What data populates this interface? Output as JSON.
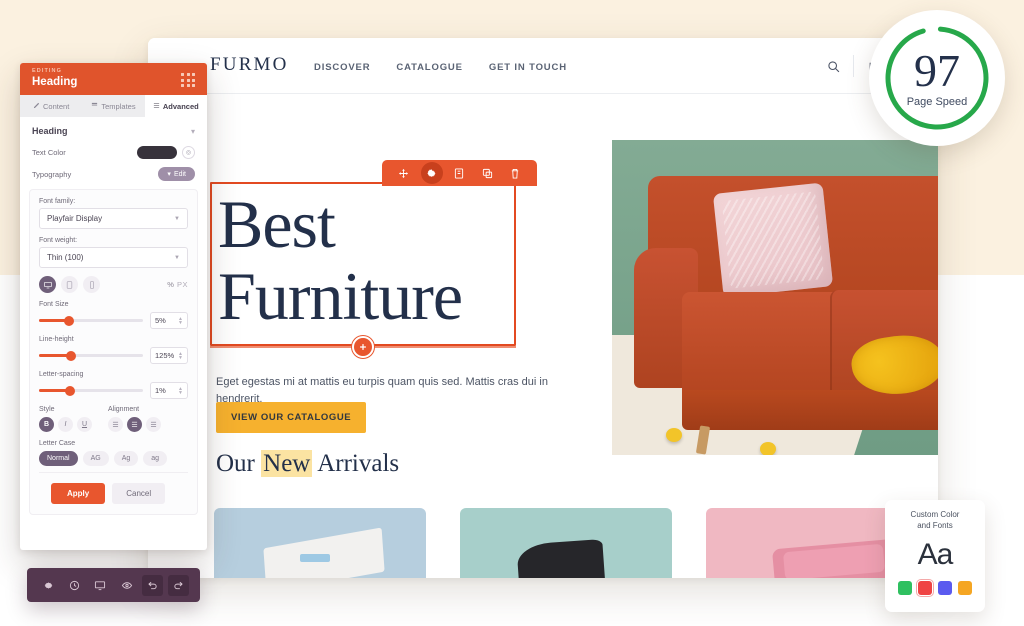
{
  "editor_panel": {
    "eyebrow": "EDITING",
    "title": "Heading",
    "drag_handle_icon": "grid-dots-icon",
    "tabs": [
      {
        "label": "Content",
        "icon": "pencil-icon",
        "active": false
      },
      {
        "label": "Templates",
        "icon": "template-icon",
        "active": false
      },
      {
        "label": "Advanced",
        "icon": "sliders-icon",
        "active": true
      }
    ],
    "section": {
      "title": "Heading",
      "collapse_icon": "chevron-down-icon"
    },
    "text_color": {
      "label": "Text Color",
      "swatch_hex": "#37323b",
      "picker_icon": "eyedropper-icon"
    },
    "typography": {
      "label": "Typography",
      "edit_label": "Edit",
      "edit_icon": "chevron-down-icon"
    },
    "font_family": {
      "label": "Font family:",
      "value": "Playfair Display",
      "caret_icon": "caret-down-icon"
    },
    "font_weight": {
      "label": "Font weight:",
      "value": "Thin (100)",
      "caret_icon": "caret-down-icon"
    },
    "devices": [
      {
        "name": "desktop-icon",
        "active": true
      },
      {
        "name": "tablet-icon",
        "active": false
      },
      {
        "name": "mobile-icon",
        "active": false
      }
    ],
    "units": {
      "percent": "%",
      "px": "PX",
      "active": "PX"
    },
    "sliders": [
      {
        "label": "Font Size",
        "value": "5%",
        "fill_pct": 28
      },
      {
        "label": "Line-height",
        "value": "125%",
        "fill_pct": 30
      },
      {
        "label": "Letter-spacing",
        "value": "1%",
        "fill_pct": 29
      }
    ],
    "style": {
      "label": "Style",
      "options": [
        {
          "glyph": "B",
          "name": "bold-button",
          "active": true
        },
        {
          "glyph": "I",
          "name": "italic-button",
          "active": false
        },
        {
          "glyph": "U",
          "name": "underline-button",
          "active": false
        }
      ]
    },
    "alignment": {
      "label": "Alignment",
      "options": [
        {
          "glyph": "☰",
          "name": "align-left-button",
          "active": false
        },
        {
          "glyph": "☰",
          "name": "align-center-button",
          "active": true
        },
        {
          "glyph": "☰",
          "name": "align-right-button",
          "active": false
        }
      ]
    },
    "letter_case": {
      "label": "Letter Case",
      "options": [
        {
          "label": "Normal",
          "active": true
        },
        {
          "label": "AG",
          "active": false
        },
        {
          "label": "Ag",
          "active": false
        },
        {
          "label": "ag",
          "active": false
        }
      ]
    },
    "footer": {
      "apply_label": "Apply",
      "cancel_label": "Cancel"
    },
    "accent_hex": "#e8562e",
    "header_hex": "#e0542c"
  },
  "bottom_toolbar": {
    "background_hex": "#54374f",
    "buttons": [
      {
        "name": "settings-gear-icon",
        "boxed": false
      },
      {
        "name": "history-clock-icon",
        "boxed": false
      },
      {
        "name": "responsive-monitor-icon",
        "boxed": false
      },
      {
        "name": "preview-eye-icon",
        "boxed": false
      },
      {
        "name": "undo-icon",
        "boxed": true
      },
      {
        "name": "redo-icon",
        "boxed": true
      }
    ]
  },
  "site": {
    "brand": "FURMO",
    "nav": [
      "DISCOVER",
      "CATALOGUE",
      "GET IN TOUCH"
    ],
    "actions": [
      {
        "name": "search-icon"
      },
      {
        "name": "bag-icon"
      }
    ],
    "hero": {
      "heading_line1": "Best",
      "heading_line2": "Furniture",
      "subtitle": "Eget egestas mi at mattis eu turpis quam quis sed. Mattis cras dui in hendrerit.",
      "cta_label": "VIEW OUR CATALOGUE"
    },
    "element_toolbar": [
      {
        "name": "move-handle-icon",
        "active": false
      },
      {
        "name": "settings-gear-icon",
        "active": true
      },
      {
        "name": "save-template-icon",
        "active": false
      },
      {
        "name": "duplicate-icon",
        "active": false
      },
      {
        "name": "delete-trash-icon",
        "active": false
      }
    ],
    "add_section_icon": "plus-circle-icon",
    "arrivals": {
      "prefix": "Our ",
      "highlight": "New",
      "suffix": " Arrivals",
      "highlight_hex": "#fbe3a2"
    },
    "cards": [
      {
        "name": "product-card-blue",
        "hex": "#b6cede"
      },
      {
        "name": "product-card-teal",
        "hex": "#a7cfca"
      },
      {
        "name": "product-card-pink",
        "hex": "#f0b8c2"
      }
    ]
  },
  "page_speed_badge": {
    "score": "97",
    "label": "Page Speed",
    "ring_hex": "#27a84a"
  },
  "font_badge": {
    "line1": "Custom Color",
    "line2": "and Fonts",
    "sample": "Aa",
    "swatches": [
      {
        "hex": "#2fc060",
        "selected": false
      },
      {
        "hex": "#ef4444",
        "selected": true
      },
      {
        "hex": "#5b5bef",
        "selected": false
      },
      {
        "hex": "#f5a623",
        "selected": false
      }
    ]
  }
}
